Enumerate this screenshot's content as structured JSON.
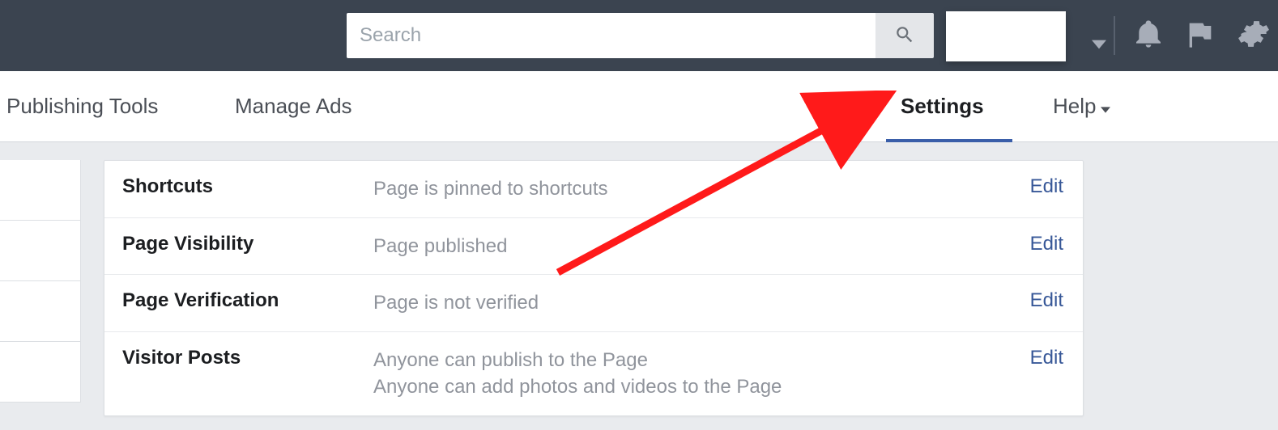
{
  "search": {
    "placeholder": "Search"
  },
  "nav": {
    "publishing_tools": "Publishing Tools",
    "manage_ads": "Manage Ads",
    "settings": "Settings",
    "help": "Help"
  },
  "settings_rows": [
    {
      "label": "Shortcuts",
      "value_lines": [
        "Page is pinned to shortcuts"
      ],
      "edit": "Edit"
    },
    {
      "label": "Page Visibility",
      "value_lines": [
        "Page published"
      ],
      "edit": "Edit"
    },
    {
      "label": "Page Verification",
      "value_lines": [
        "Page is not verified"
      ],
      "edit": "Edit"
    },
    {
      "label": "Visitor Posts",
      "value_lines": [
        "Anyone can publish to the Page",
        "Anyone can add photos and videos to the Page"
      ],
      "edit": "Edit"
    }
  ]
}
